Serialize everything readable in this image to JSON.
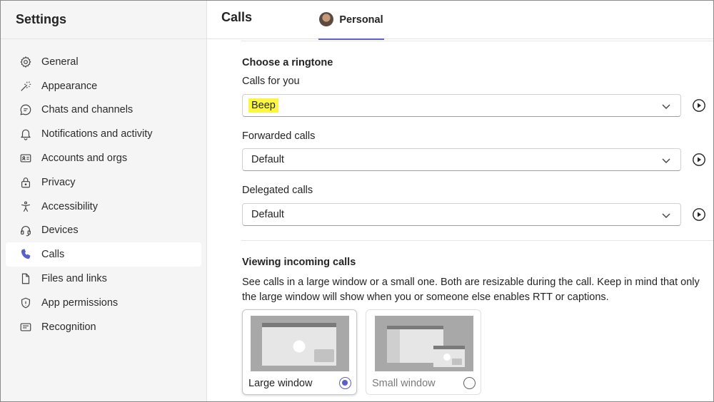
{
  "sidebar": {
    "title": "Settings",
    "items": [
      {
        "label": "General",
        "icon": "gear-icon"
      },
      {
        "label": "Appearance",
        "icon": "magic-wand-icon"
      },
      {
        "label": "Chats and channels",
        "icon": "chat-icon"
      },
      {
        "label": "Notifications and activity",
        "icon": "bell-icon"
      },
      {
        "label": "Accounts and orgs",
        "icon": "contact-card-icon"
      },
      {
        "label": "Privacy",
        "icon": "lock-icon"
      },
      {
        "label": "Accessibility",
        "icon": "accessibility-icon"
      },
      {
        "label": "Devices",
        "icon": "headset-icon"
      },
      {
        "label": "Calls",
        "icon": "phone-icon",
        "active": true
      },
      {
        "label": "Files and links",
        "icon": "file-icon"
      },
      {
        "label": "App permissions",
        "icon": "shield-icon"
      },
      {
        "label": "Recognition",
        "icon": "text-box-icon"
      }
    ]
  },
  "header": {
    "title": "Calls",
    "tab_label": "Personal"
  },
  "ringtone": {
    "section_title": "Choose a ringtone",
    "calls_for_you": {
      "label": "Calls for you",
      "value": "Beep"
    },
    "forwarded_calls": {
      "label": "Forwarded calls",
      "value": "Default"
    },
    "delegated_calls": {
      "label": "Delegated calls",
      "value": "Default"
    }
  },
  "incoming": {
    "section_title": "Viewing incoming calls",
    "description": "See calls in a large window or a small one. Both are resizable during the call. Keep in mind that only the large window will show when you or someone else enables RTT or captions.",
    "options": [
      {
        "label": "Large window",
        "selected": true
      },
      {
        "label": "Small window",
        "selected": false
      }
    ]
  },
  "colors": {
    "accent": "#5b5fc7",
    "highlight": "#fbf644",
    "sidebar_bg": "#f5f5f5"
  }
}
